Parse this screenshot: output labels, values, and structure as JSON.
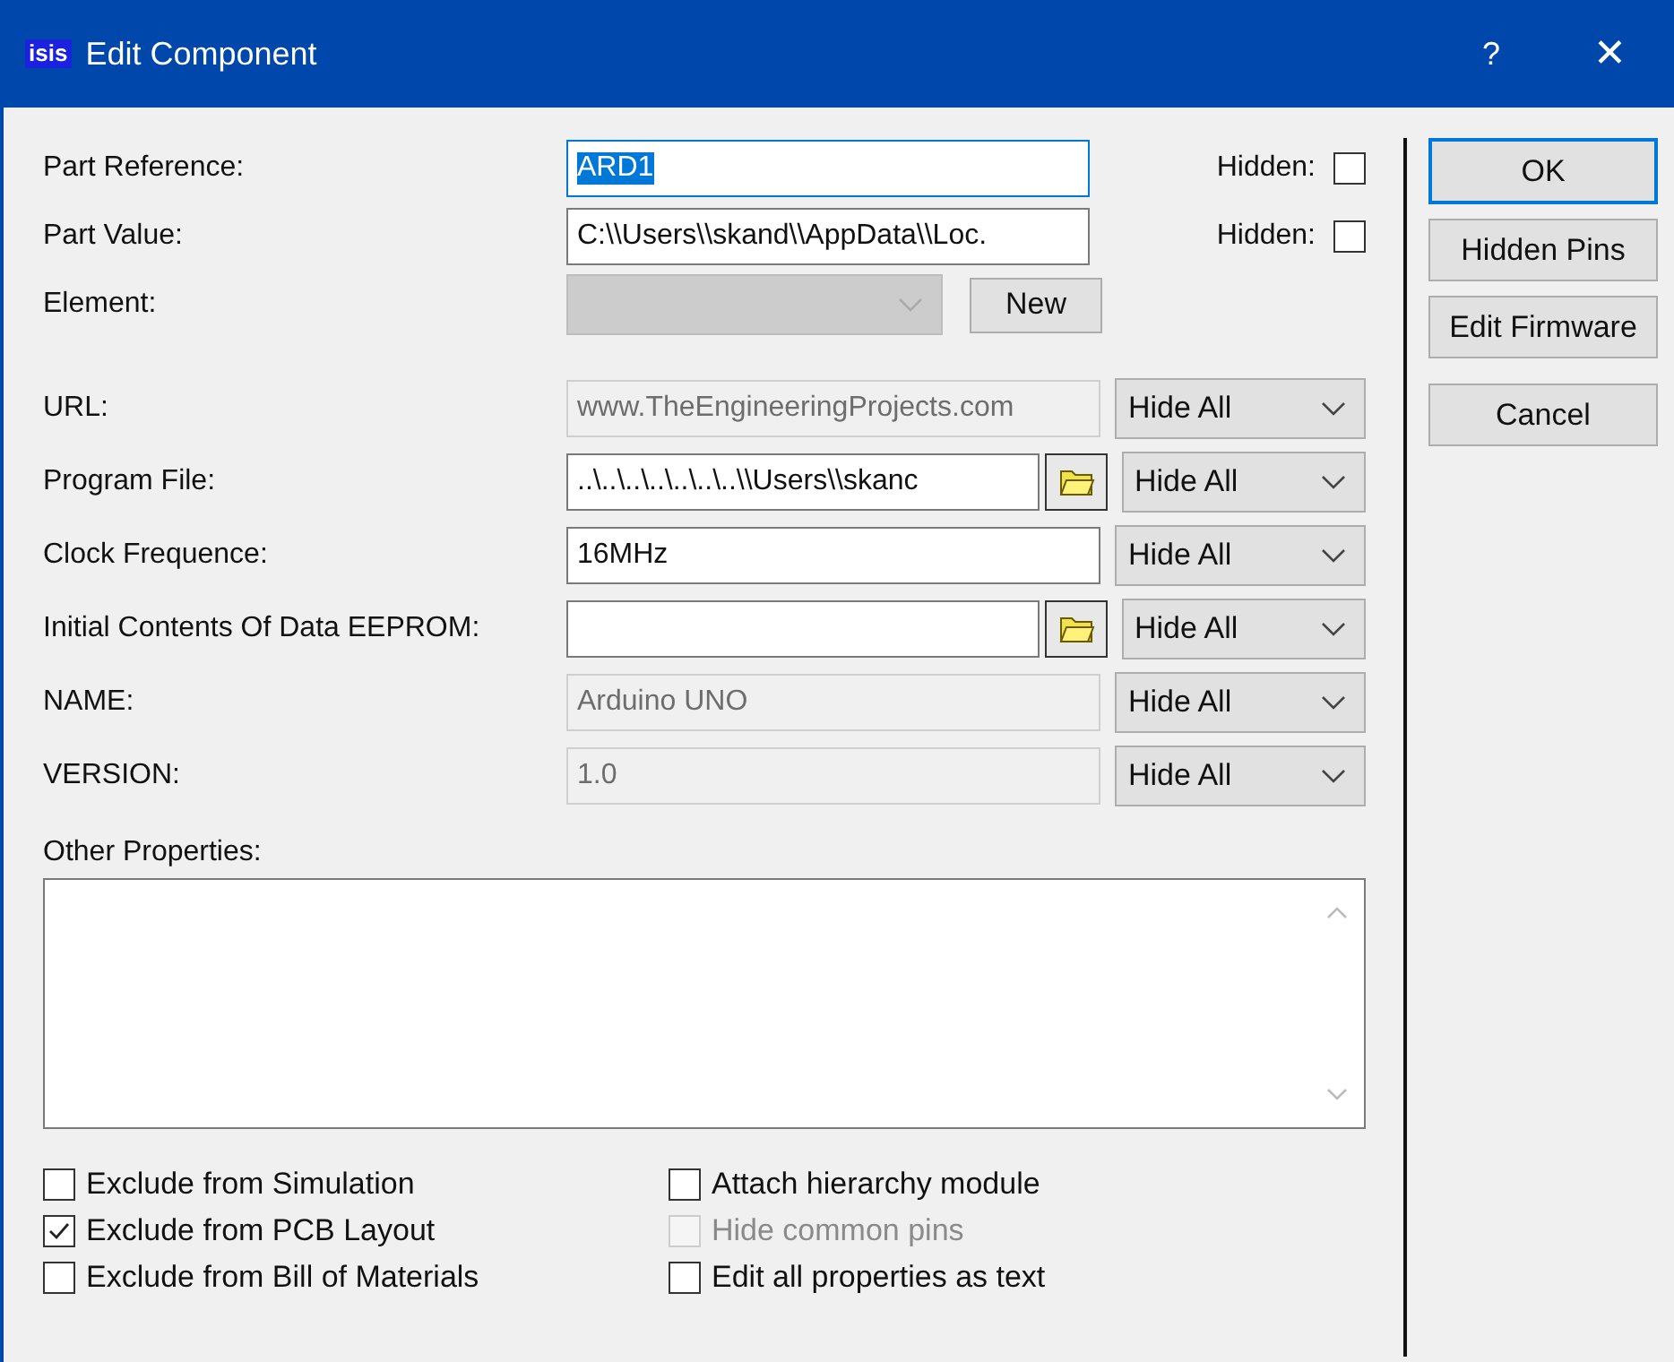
{
  "window": {
    "title": "Edit Component",
    "app_icon": "isis",
    "help": "?",
    "close": "✕"
  },
  "top_rows": [
    {
      "kind": "text",
      "label": "Part Reference:",
      "value": "ARD1",
      "text_selected": true,
      "focused": true,
      "hidden_label": "Hidden:",
      "hidden": false
    },
    {
      "kind": "text",
      "label": "Part Value:",
      "value": "C:\\\\Users\\\\skand\\\\AppData\\\\Loc.",
      "text_selected": false,
      "focused": false,
      "hidden_label": "Hidden:",
      "hidden": false
    },
    {
      "kind": "combo",
      "label": "Element:",
      "disabled": true,
      "button": "New"
    }
  ],
  "properties": [
    {
      "kind": "disabled",
      "label": "URL:",
      "value": "www.TheEngineeringProjects.com",
      "visibility": "Hide All"
    },
    {
      "kind": "file",
      "label": "Program File:",
      "value": "..\\..\\..\\..\\..\\..\\..\\\\Users\\\\skanc",
      "visibility": "Hide All"
    },
    {
      "kind": "text",
      "label": "Clock Frequence:",
      "value": "16MHz",
      "visibility": "Hide All"
    },
    {
      "kind": "file",
      "label": "Initial Contents Of Data EEPROM:",
      "visibility": "Hide All"
    },
    {
      "kind": "disabled",
      "label": "NAME:",
      "value": "Arduino UNO",
      "visibility": "Hide All"
    },
    {
      "kind": "disabled",
      "label": "VERSION:",
      "value": "1.0",
      "visibility": "Hide All"
    }
  ],
  "other_properties": {
    "label": "Other Properties:"
  },
  "options_left": [
    {
      "label": "Exclude from Simulation",
      "checked": false,
      "disabled": false
    },
    {
      "label": "Exclude from PCB Layout",
      "checked": true,
      "disabled": false
    },
    {
      "label": "Exclude from Bill of Materials",
      "checked": false,
      "disabled": false
    }
  ],
  "options_right": [
    {
      "label": "Attach hierarchy module",
      "checked": false,
      "disabled": false
    },
    {
      "label": "Hide common pins",
      "checked": false,
      "disabled": true
    },
    {
      "label": "Edit all properties as text",
      "checked": false,
      "disabled": false
    }
  ],
  "buttons": [
    {
      "label": "OK",
      "default": true
    },
    {
      "label": "Hidden Pins",
      "default": false
    },
    {
      "label": "Edit Firmware",
      "default": false
    },
    {
      "label": "Cancel",
      "default": false
    }
  ]
}
